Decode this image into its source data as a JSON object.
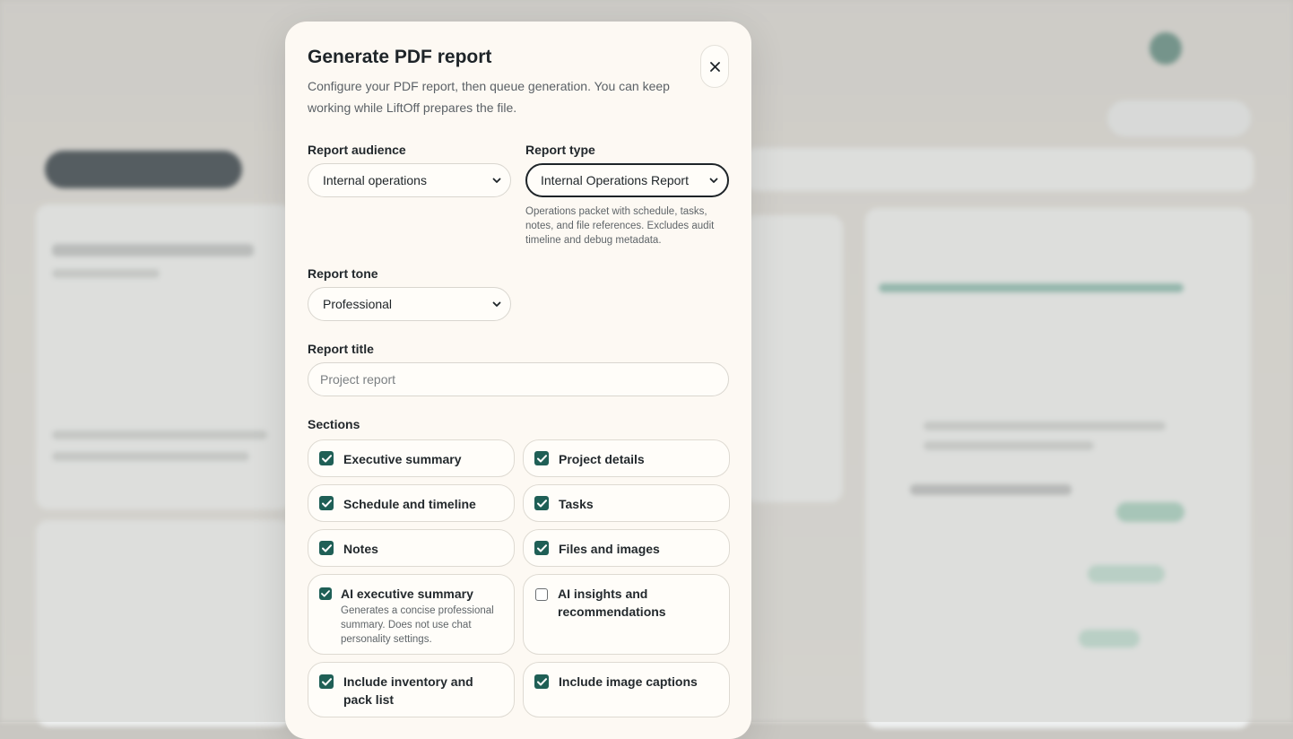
{
  "modal": {
    "title": "Generate PDF report",
    "subtitle": "Configure your PDF report, then queue generation. You can keep working while LiftOff prepares the file.",
    "close_icon": "close-icon"
  },
  "audience": {
    "label": "Report audience",
    "value": "Internal operations"
  },
  "report_type": {
    "label": "Report type",
    "value": "Internal Operations Report",
    "hint": "Operations packet with schedule, tasks, notes, and file references. Excludes audit timeline and debug metadata."
  },
  "tone": {
    "label": "Report tone",
    "value": "Professional"
  },
  "title_field": {
    "label": "Report title",
    "placeholder": "Project report"
  },
  "sections": {
    "label": "Sections",
    "items": [
      {
        "label": "Executive summary",
        "checked": true
      },
      {
        "label": "Project details",
        "checked": true
      },
      {
        "label": "Schedule and timeline",
        "checked": true
      },
      {
        "label": "Tasks",
        "checked": true
      },
      {
        "label": "Notes",
        "checked": true
      },
      {
        "label": "Files and images",
        "checked": true
      },
      {
        "label": "AI executive summary",
        "checked": true,
        "description": "Generates a concise professional summary. Does not use chat personality settings."
      },
      {
        "label": "AI insights and recommendations",
        "checked": false
      },
      {
        "label": "Include inventory and pack list",
        "checked": true
      },
      {
        "label": "Include image captions",
        "checked": true
      }
    ]
  },
  "colors": {
    "accent": "#1f5f56",
    "modal_bg": "#fdf9f3"
  }
}
